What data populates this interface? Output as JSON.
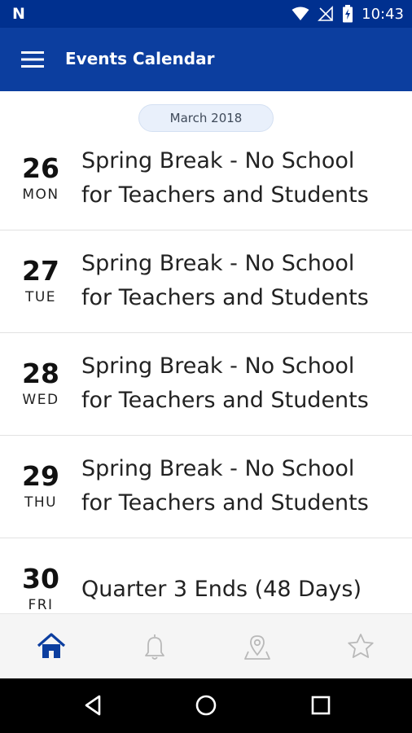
{
  "status_bar": {
    "time": "10:43",
    "logo": "N"
  },
  "app_bar": {
    "title": "Events Calendar"
  },
  "month_label": "March 2018",
  "events": [
    {
      "day": "26",
      "weekday": "MON",
      "title_line1": "Spring Break - No School",
      "title_line2": "for Teachers and Students"
    },
    {
      "day": "27",
      "weekday": "TUE",
      "title_line1": "Spring Break - No School",
      "title_line2": "for Teachers and Students"
    },
    {
      "day": "28",
      "weekday": "WED",
      "title_line1": "Spring Break - No School",
      "title_line2": "for Teachers and Students"
    },
    {
      "day": "29",
      "weekday": "THU",
      "title_line1": "Spring Break - No School",
      "title_line2": "for Teachers and Students"
    },
    {
      "day": "30",
      "weekday": "FRI",
      "title_line1": "Quarter 3 Ends (48 Days)",
      "title_line2": ""
    }
  ],
  "bottom_nav": [
    {
      "icon": "home-icon",
      "active": true
    },
    {
      "icon": "bell-icon",
      "active": false
    },
    {
      "icon": "map-pin-icon",
      "active": false
    },
    {
      "icon": "star-icon",
      "active": false
    }
  ],
  "colors": {
    "primary": "#0c3e9f",
    "status": "#00308f",
    "active_icon": "#0c3e9f",
    "inactive_icon": "#b9b9b9"
  }
}
